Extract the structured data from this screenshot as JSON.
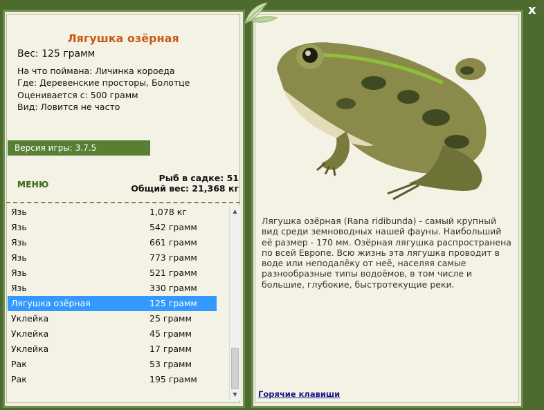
{
  "fish": {
    "name": "Лягушка озёрная",
    "weight": "Вес: 125 грамм",
    "bait": "На что поймана: Личинка короеда",
    "location": "Где: Деревенские просторы, Болотце",
    "rated": "Оценивается с: 500 грамм",
    "species": "Вид: Ловится не часто"
  },
  "version_label": "Версия игры: 3.7.5",
  "menu_label": "МЕНЮ",
  "stats": {
    "fish_count": "Рыб в садке: 51",
    "total_weight": "Общий вес: 21,368 кг"
  },
  "catch_list": [
    {
      "name": "Язь",
      "weight": "1,078 кг"
    },
    {
      "name": "Язь",
      "weight": "542 грамм"
    },
    {
      "name": "Язь",
      "weight": "661 грамм"
    },
    {
      "name": "Язь",
      "weight": "773 грамм"
    },
    {
      "name": "Язь",
      "weight": "521 грамм"
    },
    {
      "name": "Язь",
      "weight": "330 грамм"
    },
    {
      "name": "Лягушка озёрная",
      "weight": "125 грамм"
    },
    {
      "name": "Уклейка",
      "weight": "25 грамм"
    },
    {
      "name": "Уклейка",
      "weight": "45 грамм"
    },
    {
      "name": "Уклейка",
      "weight": "17 грамм"
    },
    {
      "name": "Рак",
      "weight": "53 грамм"
    },
    {
      "name": "Рак",
      "weight": "195 грамм"
    }
  ],
  "selected_index": 6,
  "description": "Лягушка озёрная (Rana ridibunda) - самый крупный вид среди земноводных нашей фауны. Наибольший её размер - 170 мм. Озёрная лягушка распространена по всей Европе. Всю жизнь эта лягушка проводит в воде или неподалёку от неё, населяя самые разнообразные типы водоёмов, в том числе и большие, глубокие, быстротекущие реки.",
  "hotkeys_label": "Горячие клавиши",
  "close_label": "x",
  "colors": {
    "background": "#4d6b2e",
    "panel": "#f3f2e4",
    "title": "#c85a14",
    "version_bar": "#587f34",
    "selection": "#3399ff"
  },
  "icons": [
    "leaf-ornament-icon",
    "frog-image",
    "scroll-up-icon",
    "scroll-down-icon"
  ]
}
